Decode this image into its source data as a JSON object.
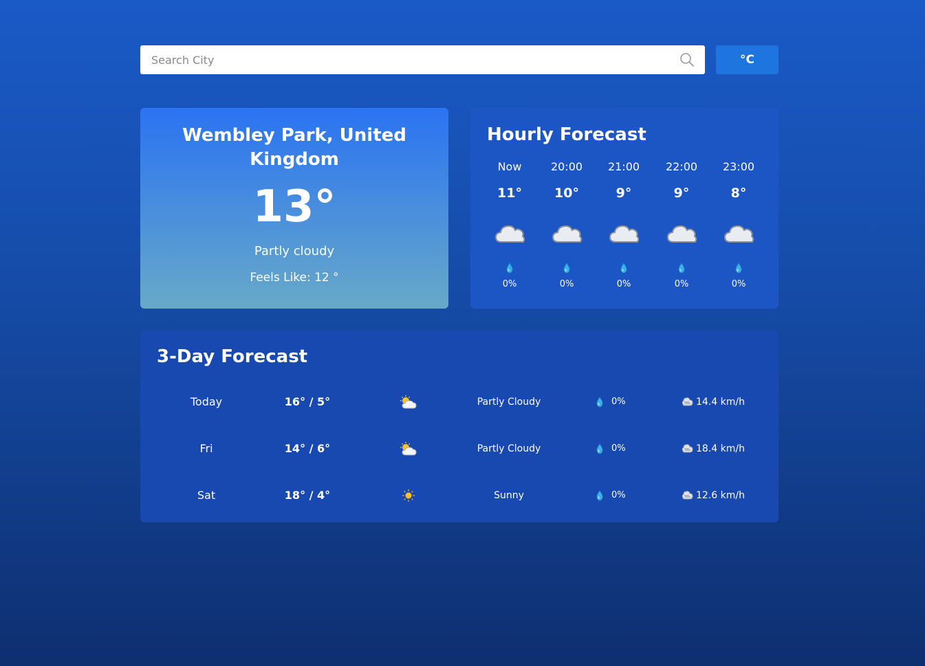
{
  "search": {
    "placeholder": "Search City"
  },
  "unit_toggle": {
    "label": "°C"
  },
  "current": {
    "city": "Wembley Park, United Kingdom",
    "temperature": "13°",
    "condition": "Partly cloudy",
    "feels_like": "Feels Like: 12 °"
  },
  "hourly": {
    "title": "Hourly Forecast",
    "items": [
      {
        "time": "Now",
        "temp": "11°",
        "icon": "cloud-icon",
        "precip": "0%"
      },
      {
        "time": "20:00",
        "temp": "10°",
        "icon": "cloud-icon",
        "precip": "0%"
      },
      {
        "time": "21:00",
        "temp": "9°",
        "icon": "cloud-icon",
        "precip": "0%"
      },
      {
        "time": "22:00",
        "temp": "9°",
        "icon": "cloud-icon",
        "precip": "0%"
      },
      {
        "time": "23:00",
        "temp": "8°",
        "icon": "cloud-icon",
        "precip": "0%"
      }
    ]
  },
  "forecast": {
    "title": "3-Day Forecast",
    "days": [
      {
        "day": "Today",
        "temps": "16° / 5°",
        "icon": "partly-cloudy-icon",
        "condition": "Partly Cloudy",
        "precip": "0%",
        "wind": "14.4 km/h"
      },
      {
        "day": "Fri",
        "temps": "14° / 6°",
        "icon": "partly-cloudy-icon",
        "condition": "Partly Cloudy",
        "precip": "0%",
        "wind": "18.4 km/h"
      },
      {
        "day": "Sat",
        "temps": "18° / 4°",
        "icon": "sun-icon",
        "condition": "Sunny",
        "precip": "0%",
        "wind": "12.6 km/h"
      }
    ]
  },
  "colors": {
    "background_top": "#1a5ac7",
    "background_bottom": "#0e2f70",
    "accent_button": "#1f75e0",
    "current_card_top": "#2a73f2",
    "current_card_bottom": "#67a9c8",
    "hourly_card": "#1c55c4",
    "forecast_card": "#1849b0"
  }
}
